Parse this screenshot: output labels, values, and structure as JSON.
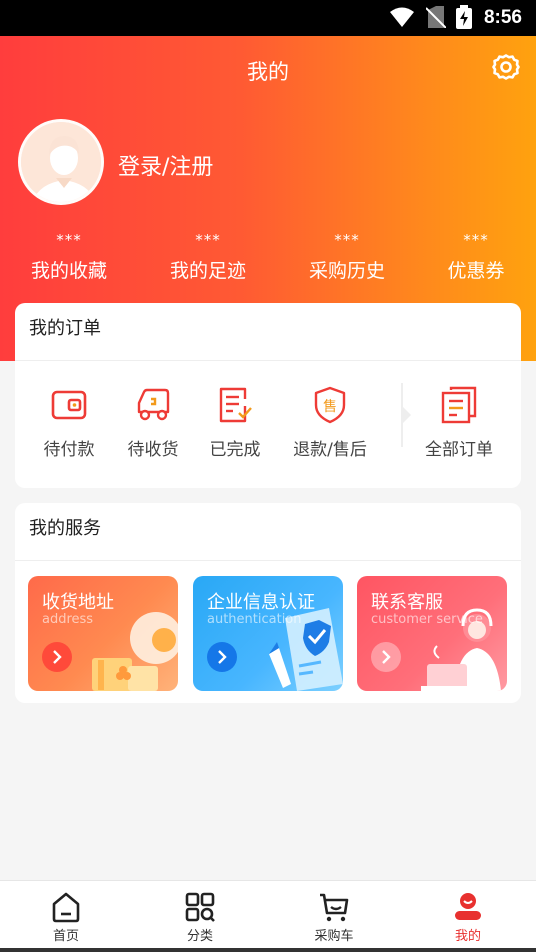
{
  "status_bar": {
    "time": "8:56"
  },
  "header": {
    "title": "我的"
  },
  "profile": {
    "login_label": "登录/注册"
  },
  "stats": [
    {
      "value": "***",
      "label": "我的收藏"
    },
    {
      "value": "***",
      "label": "我的足迹"
    },
    {
      "value": "***",
      "label": "采购历史"
    },
    {
      "value": "***",
      "label": "优惠券"
    }
  ],
  "orders": {
    "title": "我的订单",
    "items": [
      {
        "label": "待付款",
        "icon": "wallet-icon"
      },
      {
        "label": "待收货",
        "icon": "truck-icon"
      },
      {
        "label": "已完成",
        "icon": "checklist-icon"
      },
      {
        "label": "退款/售后",
        "icon": "after-sale-shield-icon"
      },
      {
        "label": "全部订单",
        "icon": "all-orders-icon"
      }
    ]
  },
  "services": {
    "title": "我的服务",
    "items": [
      {
        "title": "收货地址",
        "subtitle": "address"
      },
      {
        "title": "企业信息认证",
        "subtitle": "authentication"
      },
      {
        "title": "联系客服",
        "subtitle": "customer service"
      }
    ]
  },
  "tabbar": {
    "items": [
      {
        "label": "首页"
      },
      {
        "label": "分类"
      },
      {
        "label": "采购车"
      },
      {
        "label": "我的"
      }
    ],
    "active": "我的"
  },
  "colors": {
    "accent": "#e8312f",
    "gradient_start": "#ff3d3d",
    "gradient_end": "#ffa20e"
  }
}
